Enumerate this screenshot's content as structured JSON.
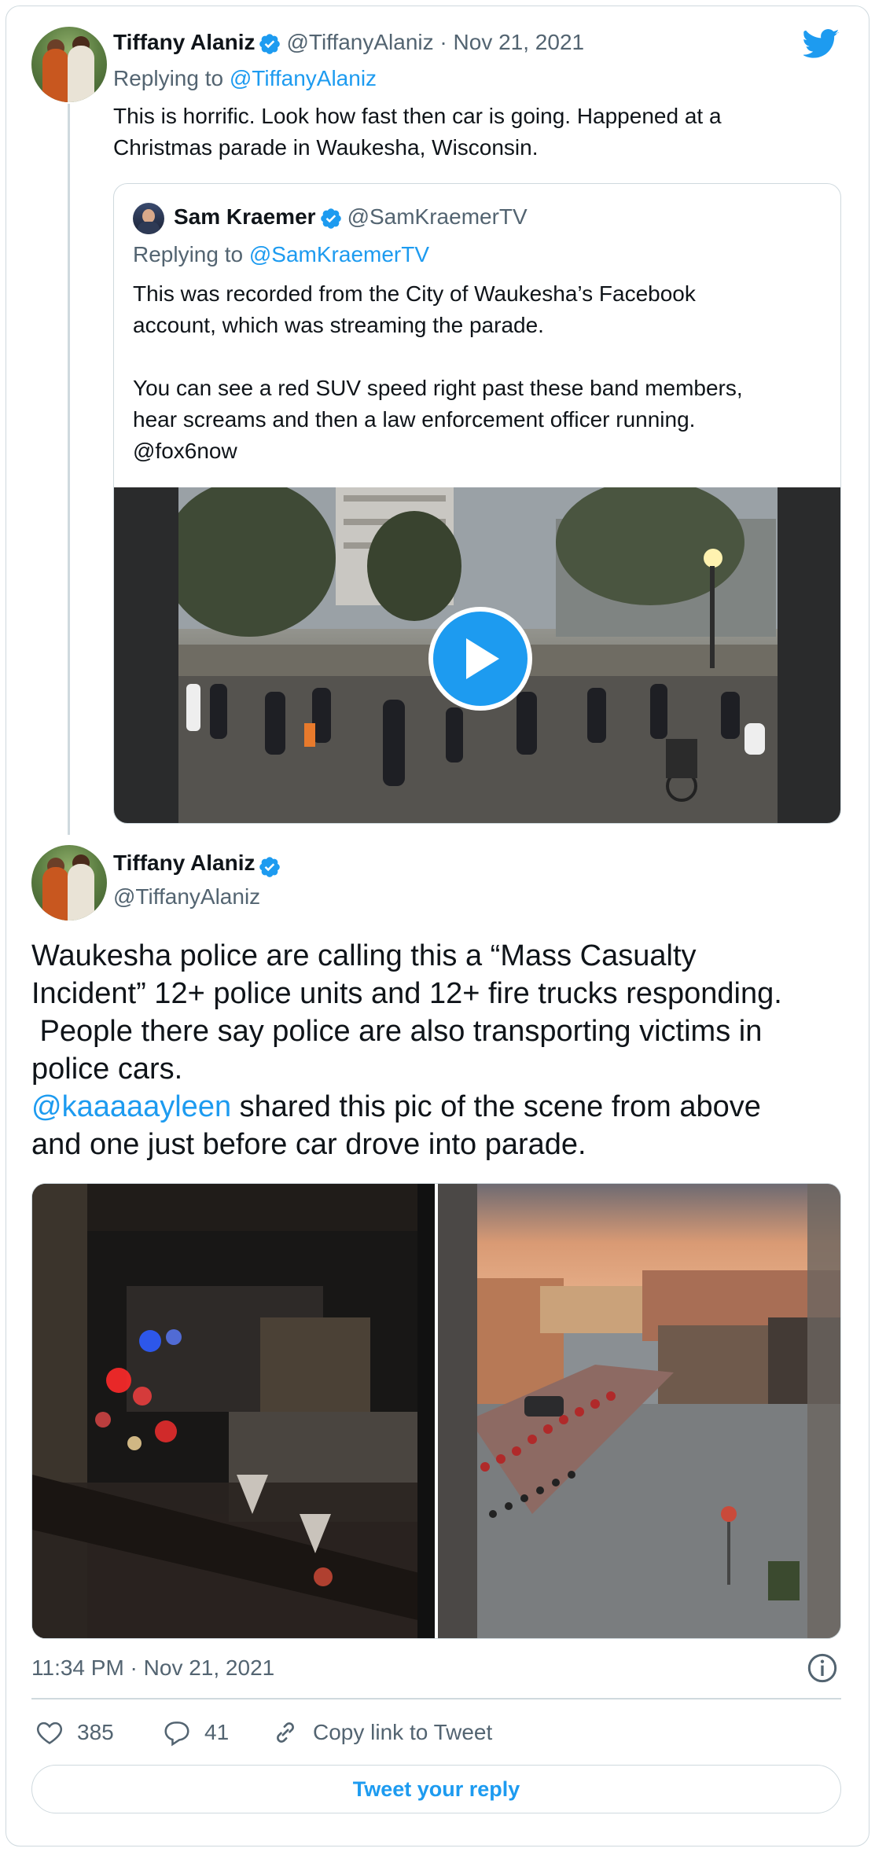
{
  "tweet_reply": {
    "author_name": "Tiffany Alaniz",
    "author_handle": "@TiffanyAlaniz",
    "separator": " · ",
    "date": "Nov 21, 2021",
    "replying_prefix": "Replying to ",
    "replying_to": "@TiffanyAlaniz",
    "text_line1": "This is horrific. Look how fast then car is going. Happened at a",
    "text_line2": "Christmas parade in Waukesha, Wisconsin."
  },
  "quoted_tweet": {
    "author_name": "Sam Kraemer",
    "author_handle": "@SamKraemerTV",
    "replying_prefix": "Replying to ",
    "replying_to": "@SamKraemerTV",
    "text_line1": "This was recorded from the City of Waukesha’s Facebook",
    "text_line2": "account, which was streaming the parade.",
    "text_line3": "You can see a red SUV speed right past these band members,",
    "text_line4": "hear screams and then a law enforcement officer running.",
    "text_line5": "@fox6now"
  },
  "main_tweet": {
    "author_name": "Tiffany Alaniz",
    "author_handle": "@TiffanyAlaniz",
    "text_line1": "Waukesha police are calling this a “Mass Casualty",
    "text_line2": "Incident” 12+ police units and 12+ fire trucks responding.",
    "text_line3": " People there say police are also transporting victims in",
    "text_line4": "police cars.",
    "mention": "@kaaaaayleen",
    "text_line5_rest": " shared this pic of the scene from above",
    "text_line6": "and one just before car drove into parade.",
    "timestamp": "11:34 PM · Nov 21, 2021"
  },
  "actions": {
    "likes": "385",
    "replies": "41",
    "copy_link": "Copy link to Tweet",
    "reply_button": "Tweet your reply"
  },
  "colors": {
    "accent": "#1d9bf0",
    "text": "#0f1419",
    "secondary": "#536471",
    "border": "#cfd9de"
  },
  "icons": [
    "twitter-logo-icon",
    "verified-badge-icon",
    "play-icon",
    "info-icon",
    "heart-icon",
    "reply-bubble-icon",
    "link-icon"
  ]
}
